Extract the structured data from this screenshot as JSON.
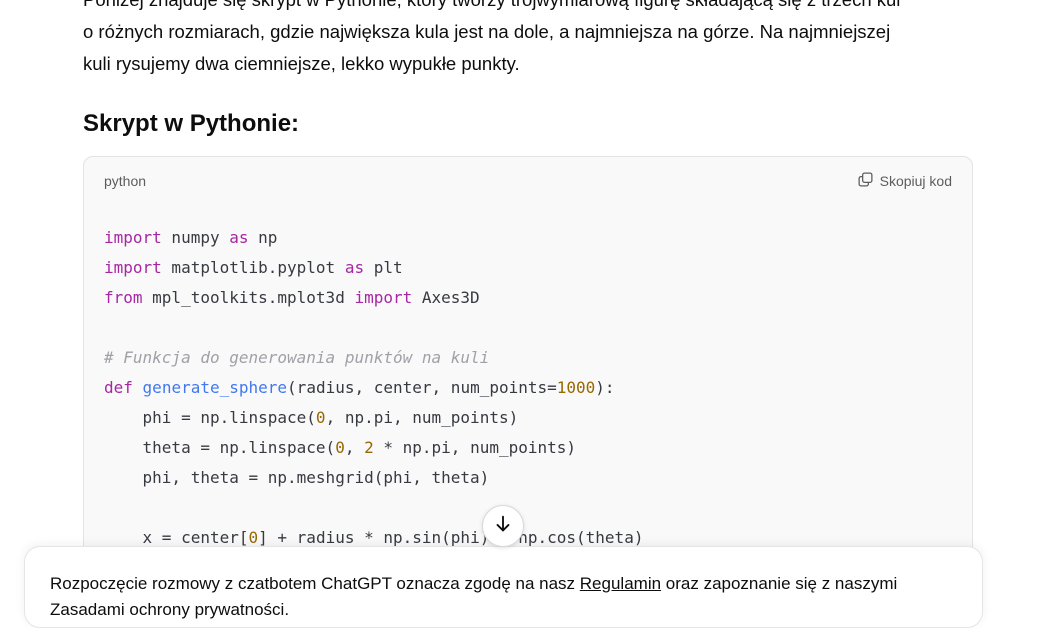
{
  "prose": {
    "line_cut": "Poniżej znajduje się skrypt w Pythonie, który tworzy trójwymiarową figurę składającą się z trzech kul",
    "line1": "o różnych rozmiarach, gdzie największa kula jest na dole, a najmniejsza na górze. Na najmniejszej",
    "line2": "kuli rysujemy dwa ciemniejsze, lekko wypukłe punkty."
  },
  "heading": "Skrypt w Pythonie:",
  "code_block": {
    "language": "python",
    "copy_label": "Skopiuj kod",
    "lines": [
      {
        "parts": [
          {
            "t": "import",
            "c": "kw"
          },
          {
            "t": " numpy "
          },
          {
            "t": "as",
            "c": "kw"
          },
          {
            "t": " np"
          }
        ]
      },
      {
        "parts": [
          {
            "t": "import",
            "c": "kw"
          },
          {
            "t": " matplotlib.pyplot "
          },
          {
            "t": "as",
            "c": "kw"
          },
          {
            "t": " plt"
          }
        ]
      },
      {
        "parts": [
          {
            "t": "from",
            "c": "kw"
          },
          {
            "t": " mpl_toolkits.mplot3d "
          },
          {
            "t": "import",
            "c": "kw"
          },
          {
            "t": " Axes3D"
          }
        ]
      },
      {
        "parts": []
      },
      {
        "parts": [
          {
            "t": "# Funkcja do generowania punktów na kuli",
            "c": "cm"
          }
        ]
      },
      {
        "parts": [
          {
            "t": "def",
            "c": "kw"
          },
          {
            "t": " "
          },
          {
            "t": "generate_sphere",
            "c": "fn"
          },
          {
            "t": "(radius, center, num_points="
          },
          {
            "t": "1000",
            "c": "num"
          },
          {
            "t": "):"
          }
        ]
      },
      {
        "parts": [
          {
            "t": "    phi = np.linspace("
          },
          {
            "t": "0",
            "c": "num"
          },
          {
            "t": ", np.pi, num_points)"
          }
        ]
      },
      {
        "parts": [
          {
            "t": "    theta = np.linspace("
          },
          {
            "t": "0",
            "c": "num"
          },
          {
            "t": ", "
          },
          {
            "t": "2",
            "c": "num"
          },
          {
            "t": " * np.pi, num_points)"
          }
        ]
      },
      {
        "parts": [
          {
            "t": "    phi, theta = np.meshgrid(phi, theta)"
          }
        ]
      },
      {
        "parts": []
      },
      {
        "parts": [
          {
            "t": "    x = center["
          },
          {
            "t": "0",
            "c": "num"
          },
          {
            "t": "] + radius * np.sin(phi) * np.cos(theta)"
          }
        ]
      }
    ]
  },
  "scroll_button": {
    "icon": "arrow-down-icon"
  },
  "consent": {
    "text_before": "Rozpoczęcie rozmowy z czatbotem ChatGPT oznacza zgodę na nasz ",
    "link_terms": "Regulamin",
    "text_after": " oraz zapoznanie się z naszymi",
    "line2": "Zasadami ochrony prywatności."
  }
}
